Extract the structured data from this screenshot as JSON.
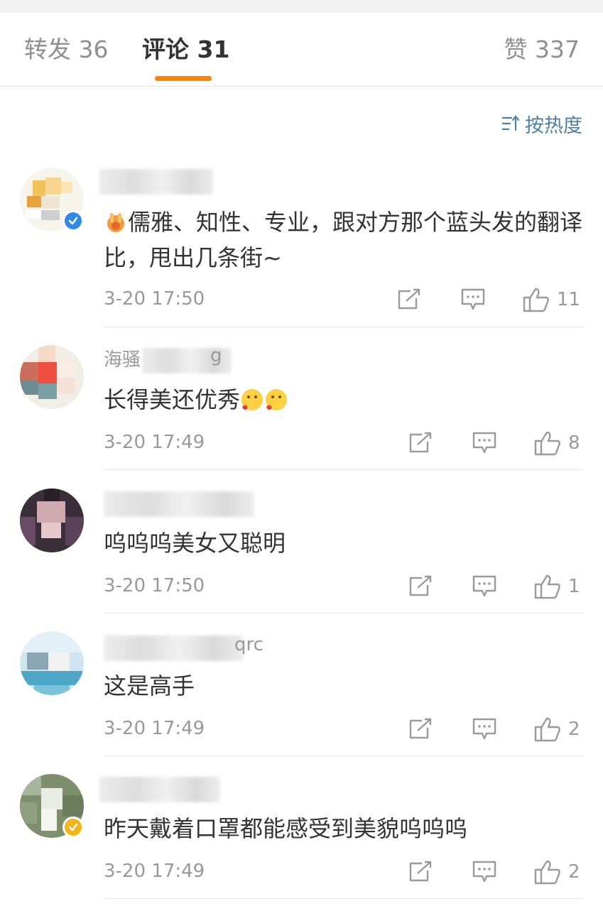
{
  "tabs": {
    "forward": "转发 36",
    "comments": "评论 31",
    "likes": "赞 337"
  },
  "sort": {
    "label": "按热度"
  },
  "colors": {
    "accent": "#ff8200",
    "link": "#4f7ea3",
    "verified_blue": "#2e8ae6",
    "verified_gold": "#f2b515"
  },
  "comments": [
    {
      "username": "",
      "text": "儒雅、知性、专业，跟对方那个蓝头发的翻译比，甩出几条街~",
      "time": "3-20 17:50",
      "likes": "11",
      "lead_emoji": "hands-emoji",
      "badge": "verified-blue"
    },
    {
      "username": "海骚",
      "username_tail": "g",
      "text": "长得美还优秀",
      "time": "3-20 17:49",
      "likes": "8",
      "trail_emoji": "kiss-emoji"
    },
    {
      "username": "",
      "text": "呜呜呜美女又聪明",
      "time": "3-20 17:50",
      "likes": "1"
    },
    {
      "username": "",
      "username_tail": "qrc",
      "text": "这是高手",
      "time": "3-20 17:49",
      "likes": "2"
    },
    {
      "username": "",
      "text": "昨天戴着口罩都能感受到美貌呜呜呜",
      "time": "3-20 17:49",
      "likes": "2",
      "badge": "verified-gold"
    }
  ]
}
